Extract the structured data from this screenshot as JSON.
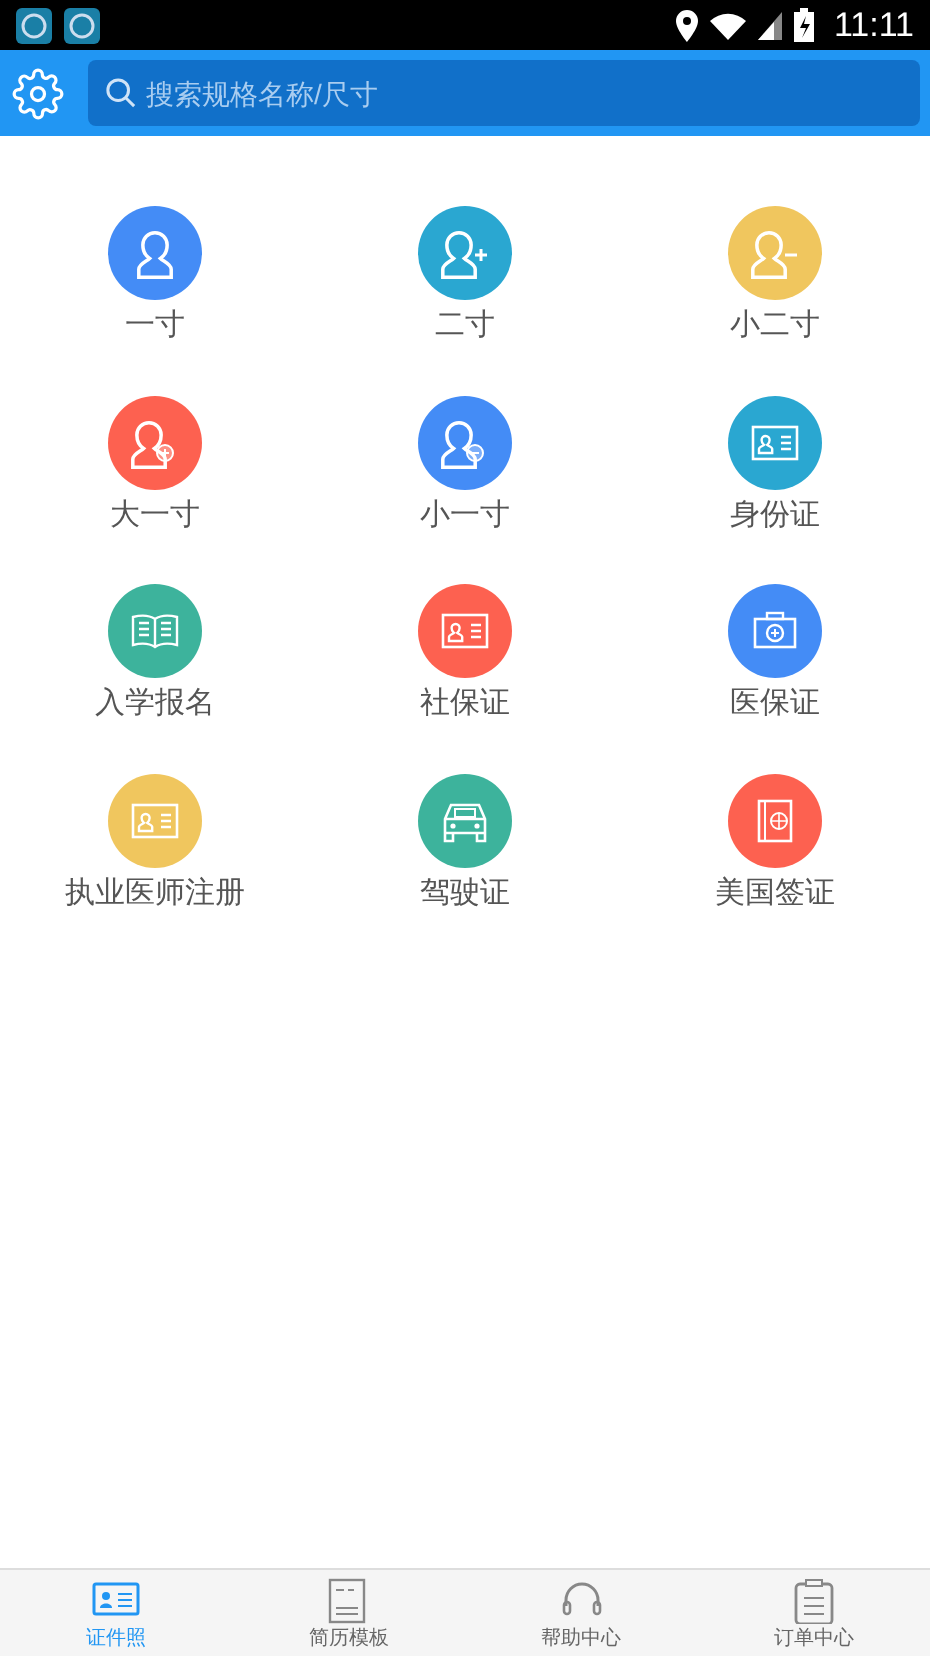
{
  "status_bar": {
    "time": "11:11"
  },
  "search": {
    "placeholder": "搜索规格名称/尺寸"
  },
  "items": [
    {
      "label": "一寸",
      "kind": "person",
      "color": "#448cf6"
    },
    {
      "label": "二寸",
      "kind": "person-plus",
      "color": "#2aa7d1"
    },
    {
      "label": "小二寸",
      "kind": "person-minus",
      "color": "#f0c65e"
    },
    {
      "label": "大一寸",
      "kind": "person-plus-circle",
      "color": "#fd6150"
    },
    {
      "label": "小一寸",
      "kind": "person-minus-circle",
      "color": "#448cf6"
    },
    {
      "label": "身份证",
      "kind": "id-card",
      "color": "#2aa7d1"
    },
    {
      "label": "入学报名",
      "kind": "book",
      "color": "#3db39c"
    },
    {
      "label": "社保证",
      "kind": "id-card",
      "color": "#fd6150"
    },
    {
      "label": "医保证",
      "kind": "medkit",
      "color": "#448cf6"
    },
    {
      "label": "执业医师注册",
      "kind": "id-card",
      "color": "#f0c65e"
    },
    {
      "label": "驾驶证",
      "kind": "car",
      "color": "#3db39c"
    },
    {
      "label": "美国签证",
      "kind": "passport",
      "color": "#fd6150"
    }
  ],
  "tabs": [
    {
      "label": "证件照",
      "kind": "id",
      "selected": true
    },
    {
      "label": "简历模板",
      "kind": "resume",
      "selected": false
    },
    {
      "label": "帮助中心",
      "kind": "headset",
      "selected": false
    },
    {
      "label": "订单中心",
      "kind": "clipboard",
      "selected": false
    }
  ]
}
